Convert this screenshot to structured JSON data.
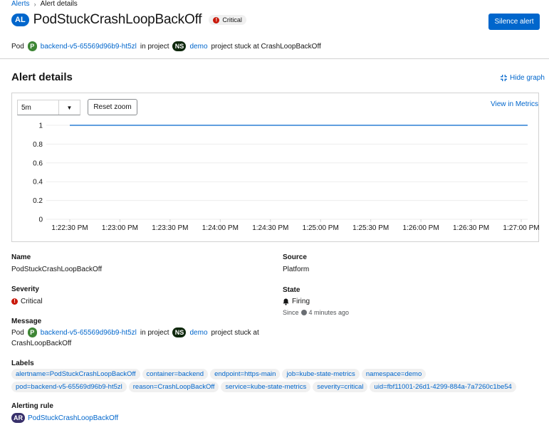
{
  "breadcrumb": {
    "parent": "Alerts",
    "current": "Alert details"
  },
  "header": {
    "badge": "AL",
    "title": "PodStuckCrashLoopBackOff",
    "severity": "Critical",
    "severity_icon": "error-circle-icon",
    "action_button": "Silence alert"
  },
  "subtitle": {
    "prefix": "Pod",
    "pod_badge": "P",
    "pod_name": "backend-v5-65569d96b9-ht5zl",
    "middle": "in project",
    "ns_badge": "NS",
    "ns_name": "demo",
    "suffix": "project stuck at CrashLoopBackOff"
  },
  "section": {
    "title": "Alert details",
    "hide_graph": "Hide graph",
    "hide_graph_icon": "compress-icon"
  },
  "graph": {
    "interval": "5m",
    "reset_zoom": "Reset zoom",
    "view_in_metrics": "View in Metrics"
  },
  "chart_data": {
    "type": "line",
    "x": [
      "1:22:30 PM",
      "1:23:00 PM",
      "1:23:30 PM",
      "1:24:00 PM",
      "1:24:30 PM",
      "1:25:00 PM",
      "1:25:30 PM",
      "1:26:00 PM",
      "1:26:30 PM",
      "1:27:00 PM"
    ],
    "y_ticks": [
      "1",
      "0.8",
      "0.6",
      "0.4",
      "0.2",
      "0"
    ],
    "ylim": [
      0,
      1
    ],
    "series": [
      {
        "values": [
          1,
          1,
          1,
          1,
          1,
          1,
          1,
          1,
          1,
          1
        ],
        "color": "#0066cc"
      }
    ],
    "grid": true
  },
  "details": {
    "name_label": "Name",
    "name_value": "PodStuckCrashLoopBackOff",
    "source_label": "Source",
    "source_value": "Platform",
    "severity_label": "Severity",
    "severity_value": "Critical",
    "state_label": "State",
    "state_value": "Firing",
    "state_icon": "bell-icon",
    "since_prefix": "Since",
    "since_value": "4 minutes ago",
    "message_label": "Message",
    "message_prefix": "Pod",
    "message_pod_badge": "P",
    "message_pod": "backend-v5-65569d96b9-ht5zl",
    "message_middle": "in project",
    "message_ns_badge": "NS",
    "message_ns": "demo",
    "message_suffix_1": "project stuck at",
    "message_suffix_2": "CrashLoopBackOff",
    "labels_label": "Labels",
    "labels": [
      "alertname=PodStuckCrashLoopBackOff",
      "container=backend",
      "endpoint=https-main",
      "job=kube-state-metrics",
      "namespace=demo",
      "pod=backend-v5-65569d96b9-ht5zl",
      "reason=CrashLoopBackOff",
      "service=kube-state-metrics",
      "severity=critical",
      "uid=fbf11001-26d1-4299-884a-7a7260c1be54"
    ],
    "rule_label": "Alerting rule",
    "rule_badge": "AR",
    "rule_value": "PodStuckCrashLoopBackOff"
  },
  "colors": {
    "primary": "#0066cc",
    "danger": "#c9190b",
    "pod_badge": "#3e8635",
    "ns_badge": "#0f280d",
    "rule_badge": "#38306b"
  }
}
